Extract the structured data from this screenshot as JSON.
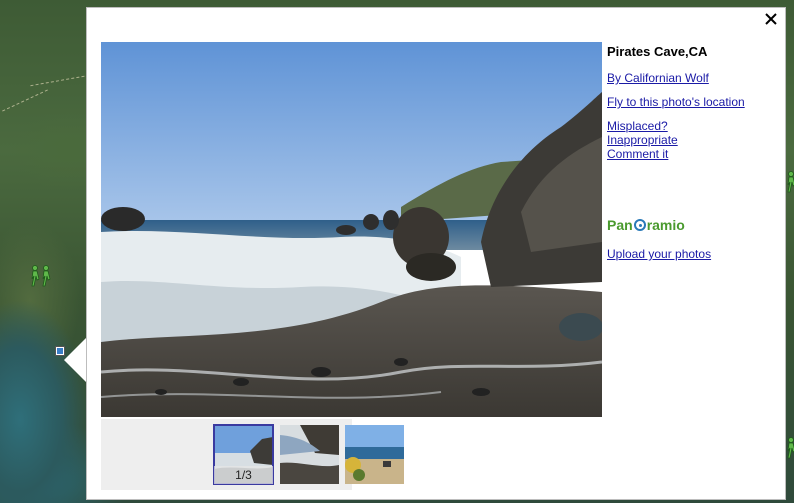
{
  "photo": {
    "title": "Pirates Cave,CA",
    "author_link": "By Californian Wolf",
    "fly_link": "Fly to this photo's location",
    "misplaced_link": "Misplaced?",
    "inappropriate_link": "Inappropriate",
    "comment_link": "Comment it",
    "upload_link": "Upload your photos"
  },
  "brand": {
    "logo_pre": "Pan",
    "logo_post": "ramio",
    "logo_color": "#4a9a2e"
  },
  "thumbnails": {
    "counter": "1/3"
  },
  "icons": {
    "close": "close-icon",
    "hiker": "hiker-icon",
    "photo_marker": "photo-marker-icon"
  },
  "colors": {
    "link": "#1a1aa6",
    "selected_thumb_border": "#3a3aa0"
  }
}
